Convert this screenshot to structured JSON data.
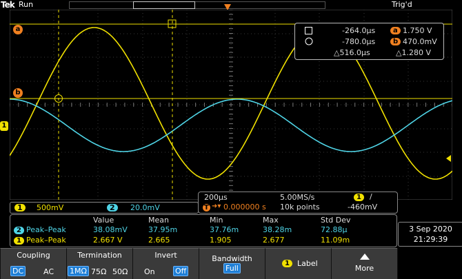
{
  "header": {
    "brand": "Tek",
    "status": "Run",
    "trigger_state": "Trig'd",
    "trigger_marker": "T"
  },
  "markers": {
    "cursor_a": "a",
    "cursor_b": "b",
    "ch1": "1"
  },
  "cursor_readout": {
    "t1": "-264.0µs",
    "v1_label": "a",
    "v1": "1.750 V",
    "t2": "-780.0µs",
    "v2_label": "b",
    "v2": "470.0mV",
    "dt": "△516.0µs",
    "dv": "△1.280 V"
  },
  "channels": {
    "ch1": {
      "label": "1",
      "scale": "500mV",
      "color": "#f0e000"
    },
    "ch2": {
      "label": "2",
      "scale": "20.0mV",
      "color": "#4fd4e6"
    }
  },
  "horizontal": {
    "timebase": "200µs",
    "sample_rate": "5.00MS/s",
    "trigger_pos_label": "T",
    "trigger_pos": "0.000000 s",
    "record_length": "10k points",
    "trig_src": "1",
    "trig_slope": "/",
    "trig_level": "-460mV"
  },
  "measurements": {
    "headers": [
      "Value",
      "Mean",
      "Min",
      "Max",
      "Std Dev"
    ],
    "rows": [
      {
        "ch": "2",
        "name": "Peak–Peak",
        "value": "38.08mV",
        "mean": "37.95m",
        "min": "37.76m",
        "max": "38.28m",
        "std": "72.88µ"
      },
      {
        "ch": "1",
        "name": "Peak–Peak",
        "value": "2.667 V",
        "mean": "2.665",
        "min": "1.905",
        "max": "2.677",
        "std": "11.09m"
      }
    ]
  },
  "datetime": {
    "date": "3 Sep 2020",
    "time": "21:29:39"
  },
  "menu": {
    "coupling": {
      "title": "Coupling",
      "opt1": "DC",
      "opt2": "AC"
    },
    "termination": {
      "title": "Termination",
      "opt1": "1MΩ",
      "opt2": "75Ω",
      "opt3": "50Ω"
    },
    "invert": {
      "title": "Invert",
      "opt1": "On",
      "opt2": "Off"
    },
    "bandwidth": {
      "title": "Bandwidth",
      "value": "Full"
    },
    "label": {
      "ch": "1",
      "title": "Label"
    },
    "more": {
      "title": "More"
    }
  }
}
